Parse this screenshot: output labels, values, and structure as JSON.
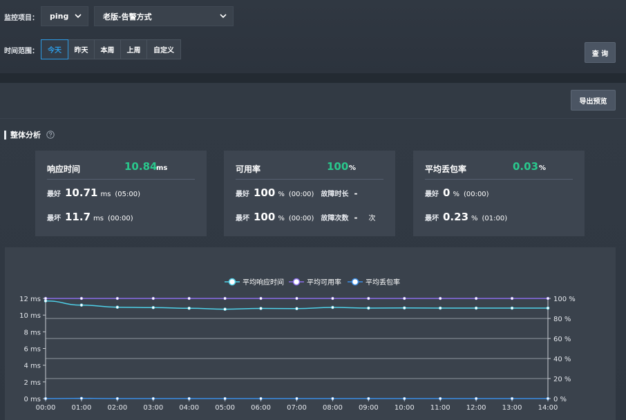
{
  "filters": {
    "monitor_label": "监控项目：",
    "monitor_select": "ping",
    "mode_select": "老版-告警方式",
    "range_label": "时间范围：",
    "ranges": [
      "今天",
      "昨天",
      "本周",
      "上周",
      "自定义"
    ],
    "active_range": "今天",
    "query_label": "查 询"
  },
  "export_label": "导出预览",
  "section_title": "整体分析",
  "cards": {
    "response": {
      "title": "响应时间",
      "value": "10.84",
      "unit": "ms",
      "best_label": "最好",
      "best_value": "10.71",
      "best_unit": "ms",
      "best_time": "(05:00)",
      "worst_label": "最坏",
      "worst_value": "11.7",
      "worst_unit": "ms",
      "worst_time": "(00:00)"
    },
    "availability": {
      "title": "可用率",
      "value": "100",
      "unit": "%",
      "best_label": "最好",
      "best_value": "100",
      "best_unit": "%",
      "best_time": "(00:00)",
      "fault_dur_label": "故障时长",
      "fault_dur_value": "-",
      "worst_label": "最坏",
      "worst_value": "100",
      "worst_unit": "%",
      "worst_time": "(00:00)",
      "fault_cnt_label": "故障次数",
      "fault_cnt_value": "-",
      "fault_cnt_unit": "次"
    },
    "loss": {
      "title": "平均丢包率",
      "value": "0.03",
      "unit": "%",
      "best_label": "最好",
      "best_value": "0",
      "best_unit": "%",
      "best_time": "(00:00)",
      "worst_label": "最坏",
      "worst_value": "0.23",
      "worst_unit": "%",
      "worst_time": "(01:00)"
    }
  },
  "colors": {
    "accent": "#2d9ce6",
    "value_green": "#29c98d",
    "series_response": "#4fd2ea",
    "series_availability": "#8a6de9",
    "series_loss": "#3a8ee6"
  },
  "chart_data": {
    "type": "line",
    "x": [
      "00:00",
      "01:00",
      "02:00",
      "03:00",
      "04:00",
      "05:00",
      "06:00",
      "07:00",
      "08:00",
      "09:00",
      "10:00",
      "11:00",
      "12:00",
      "13:00",
      "14:00"
    ],
    "series": [
      {
        "name": "平均响应时间",
        "axis": "left",
        "values": [
          11.7,
          11.2,
          10.95,
          10.9,
          10.82,
          10.71,
          10.8,
          10.78,
          10.92,
          10.84,
          10.86,
          10.84,
          10.84,
          10.84,
          10.84
        ]
      },
      {
        "name": "平均可用率",
        "axis": "right",
        "values": [
          100,
          100,
          100,
          100,
          100,
          100,
          100,
          100,
          100,
          100,
          100,
          100,
          100,
          100,
          100
        ]
      },
      {
        "name": "平均丢包率",
        "axis": "right",
        "values": [
          0,
          0.23,
          0,
          0,
          0,
          0,
          0,
          0,
          0,
          0,
          0,
          0,
          0,
          0,
          0
        ]
      }
    ],
    "y_left": {
      "ticks": [
        "0 ms",
        "2 ms",
        "4 ms",
        "6 ms",
        "8 ms",
        "10 ms",
        "12 ms"
      ],
      "range": [
        0,
        12
      ]
    },
    "y_right": {
      "ticks": [
        "0 %",
        "20 %",
        "40 %",
        "60 %",
        "80 %",
        "100 %"
      ],
      "range": [
        0,
        100
      ]
    },
    "legend_position": "top-center",
    "grid": true
  }
}
